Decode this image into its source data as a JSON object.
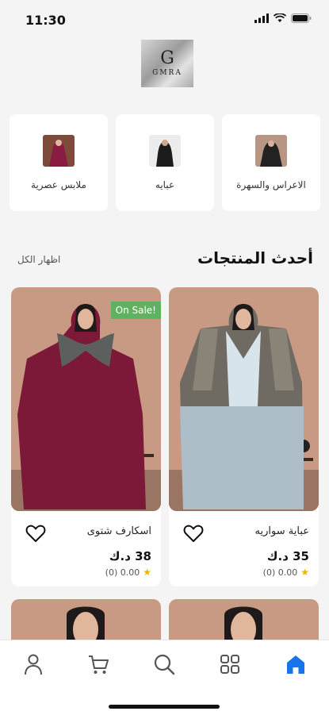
{
  "status_bar": {
    "time": "11:30"
  },
  "brand": {
    "logo_mark": "G",
    "logo_text": "GMRA"
  },
  "categories": [
    {
      "label": "ملابس عصرية"
    },
    {
      "label": "عبايه"
    },
    {
      "label": "الاعراس والسهرة"
    }
  ],
  "section": {
    "title": "أحدث المنتجات",
    "view_all": "اظهار الكل"
  },
  "products": [
    {
      "name": "اسكارف شتوى",
      "price": "38 د.ك",
      "rating": "0.00 (0)",
      "badge": "On Sale!"
    },
    {
      "name": "عباية سواريه",
      "price": "35 د.ك",
      "rating": "0.00 (0)",
      "badge": ""
    }
  ],
  "tab_bar": {
    "items": [
      {
        "icon": "person-icon"
      },
      {
        "icon": "cart-icon"
      },
      {
        "icon": "search-icon"
      },
      {
        "icon": "grid-icon"
      },
      {
        "icon": "home-icon"
      }
    ],
    "active_color": "#1a73e8"
  },
  "colors": {
    "sale_badge": "#5fb25f",
    "star": "#f0b400"
  }
}
